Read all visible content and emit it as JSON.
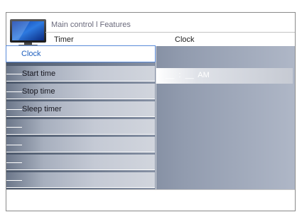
{
  "header": {
    "breadcrumb": "Main control l Features",
    "left_column_title": "Timer",
    "right_column_title": "Clock"
  },
  "menu": {
    "items": [
      {
        "label": "Clock",
        "selected": true
      },
      {
        "label": "Start time",
        "selected": false
      },
      {
        "label": "Stop time",
        "selected": false
      },
      {
        "label": "Sleep timer",
        "selected": false
      },
      {
        "label": "",
        "selected": false
      },
      {
        "label": "",
        "selected": false
      },
      {
        "label": "",
        "selected": false
      },
      {
        "label": "",
        "selected": false
      }
    ]
  },
  "value_panel": {
    "clock_value": "__  :  __  AM"
  },
  "colors": {
    "selected_text": "#1e5fbe",
    "menu_gradient_dark": "#4c586b",
    "menu_gradient_light": "#afb7c7"
  },
  "icons": {
    "header_icon": "tv-icon"
  }
}
